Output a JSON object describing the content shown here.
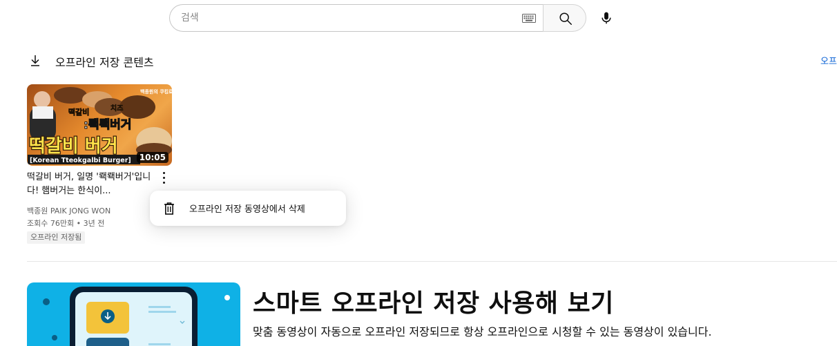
{
  "search": {
    "placeholder": "검색"
  },
  "header": {
    "title": "오프라인 저장 콘텐츠",
    "link_label": "오프"
  },
  "video": {
    "thumbnail_text_main": "떡갈비 버거",
    "thumbnail_text_sub": ":뢕뢕버거",
    "thumbnail_caption": "[Korean Tteokgalbi Burger]",
    "thumbnail_tag_1": "떡갈비",
    "thumbnail_tag_2": "치즈",
    "thumbnail_tag_3": "백종원의 쿠킹로그",
    "duration": "10:05",
    "title": "떡갈비 버거, 일명 '뢕뢕버거'입니다! 햄버거는 한식이...",
    "channel": "백종원 PAIK JONG WON",
    "meta": "조회수 76만회 • 3년 전",
    "badge": "오프라인 저장됨"
  },
  "menu": {
    "delete_label": "오프라인 저장 동영상에서 삭제"
  },
  "promo": {
    "title": "스마트 오프라인 저장 사용해 보기",
    "description": "맞춤 동영상이 자동으로 오프라인 저장되므로 항상 오프라인으로 시청할 수 있는 동영상이 있습니다."
  },
  "icons": {
    "keyboard": "keyboard-icon",
    "search": "search-icon",
    "mic": "mic-icon",
    "download": "download-icon",
    "more": "more-vert-icon",
    "trash": "trash-icon"
  },
  "colors": {
    "link": "#065fd4",
    "promo_background": "#0fb1e6",
    "thumbnail_accent": "#e58a2d"
  }
}
